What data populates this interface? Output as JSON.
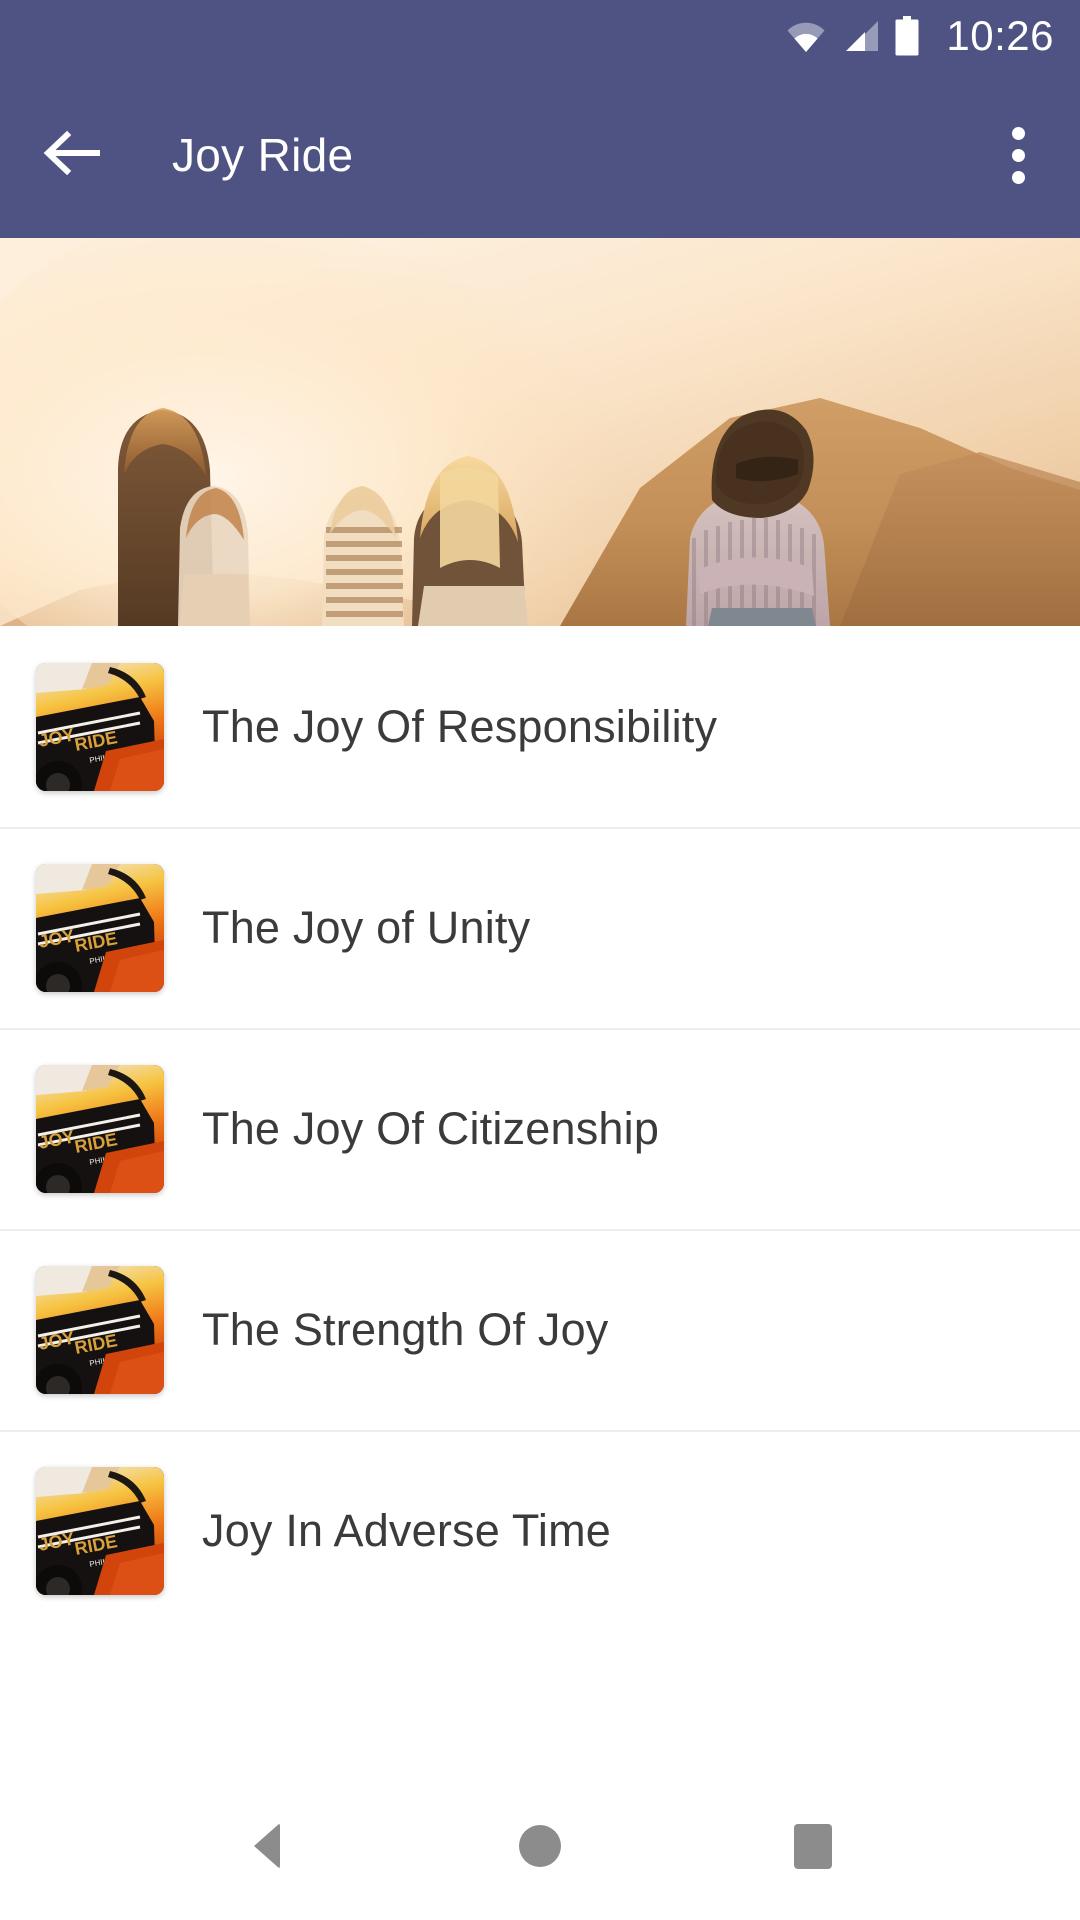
{
  "status_bar": {
    "time": "10:26",
    "icons": [
      "wifi-icon",
      "cellular-signal-icon",
      "battery-icon"
    ],
    "background_color": "#4f5384"
  },
  "app_bar": {
    "title": "Joy Ride",
    "back_icon": "back-arrow-icon",
    "overflow_icon": "overflow-menu-icon",
    "background_color": "#4f5384",
    "text_color": "#ffffff"
  },
  "hero": {
    "alt": "Group of friends standing outdoors at sunset in front of hills",
    "name": "hero-banner-image"
  },
  "list": {
    "items": [
      {
        "title": "The Joy Of Responsibility",
        "thumb_alt": "Joy Ride Philippians album art"
      },
      {
        "title": "The Joy of Unity",
        "thumb_alt": "Joy Ride Philippians album art"
      },
      {
        "title": "The Joy Of Citizenship",
        "thumb_alt": "Joy Ride Philippians album art"
      },
      {
        "title": "The Strength Of Joy",
        "thumb_alt": "Joy Ride Philippians album art"
      },
      {
        "title": "Joy In Adverse Time",
        "thumb_alt": "Joy Ride Philippians album art"
      }
    ],
    "thumbnail_text": {
      "line1": "JOY",
      "line2": "RIDE",
      "line3": "PHILIPPIANS"
    },
    "divider_color": "#ededed",
    "text_color": "#3b3b3b"
  },
  "nav_bar": {
    "buttons": [
      {
        "name": "nav-back-button",
        "icon": "triangle-back-icon"
      },
      {
        "name": "nav-home-button",
        "icon": "circle-home-icon"
      },
      {
        "name": "nav-recents-button",
        "icon": "square-recents-icon"
      }
    ],
    "icon_color": "#8c8c8c",
    "background_color": "#ffffff"
  }
}
